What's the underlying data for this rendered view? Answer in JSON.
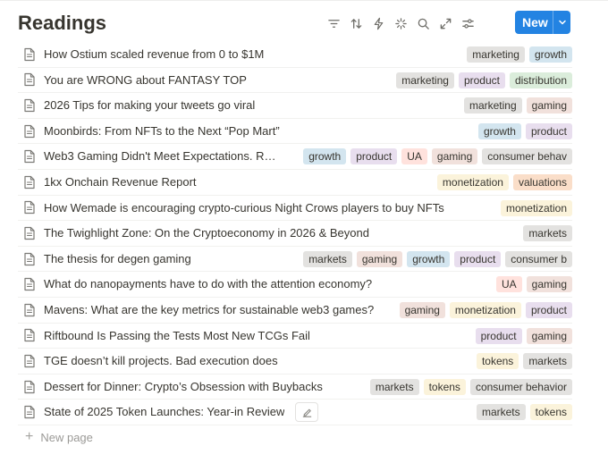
{
  "page": {
    "title": "Readings"
  },
  "toolbar": {
    "tools": [
      "filter-icon",
      "sort-icon",
      "automation-bolt-icon",
      "sparkle-icon",
      "search-icon",
      "expand-icon",
      "settings-sliders-icon"
    ],
    "new_label": "New"
  },
  "colors": {
    "marketing": "#e3e2e0",
    "growth": "#d3e5ef",
    "product": "#e8deee",
    "distribution": "#dbeddb",
    "gaming": "#f1e1dc",
    "UA": "#ffe2dd",
    "consumer behavior": "#e3e2e0",
    "monetization": "#fbf3db",
    "valuations": "#fadec9",
    "markets": "#e3e2e0",
    "tokens": "#fbf3db"
  },
  "rows": [
    {
      "name": "How Ostium scaled revenue from 0 to $1M",
      "tags": [
        "marketing",
        "growth"
      ]
    },
    {
      "name": "You are WRONG about FANTASY TOP",
      "tags": [
        "marketing",
        "product",
        "distribution"
      ]
    },
    {
      "name": "2026 Tips for making your tweets go viral",
      "tags": [
        "marketing",
        "gaming"
      ]
    },
    {
      "name": "Moonbirds: From NFTs to the Next “Pop Mart”",
      "tags": [
        "growth",
        "product"
      ]
    },
    {
      "name": "Web3 Gaming Didn't Meet Expectations. Rew...",
      "tags": [
        "growth",
        "product",
        "UA",
        "gaming",
        "consumer behav"
      ]
    },
    {
      "name": "1kx Onchain Revenue Report",
      "tags": [
        "monetization",
        "valuations"
      ]
    },
    {
      "name": "How Wemade is encouraging crypto-curious Night Crows players to buy NFTs",
      "tags": [
        "monetization"
      ]
    },
    {
      "name": "The Twighlight Zone: On the Cryptoeconomy in 2026 & Beyond",
      "tags": [
        "markets"
      ]
    },
    {
      "name": "The thesis for degen gaming",
      "tags": [
        "markets",
        "gaming",
        "growth",
        "product",
        "consumer b"
      ]
    },
    {
      "name": "What do nanopayments have to do with the attention economy?",
      "tags": [
        "UA",
        "gaming"
      ]
    },
    {
      "name": "Mavens: What are the key metrics for sustainable web3 games?",
      "tags": [
        "gaming",
        "monetization",
        "product"
      ]
    },
    {
      "name": "Riftbound Is Passing the Tests Most New TCGs Fail",
      "tags": [
        "product",
        "gaming"
      ]
    },
    {
      "name": "TGE doesn’t kill projects. Bad execution does",
      "tags": [
        "tokens",
        "markets"
      ]
    },
    {
      "name": "Dessert for Dinner: Crypto’s Obsession with Buybacks",
      "tags": [
        "markets",
        "tokens",
        "consumer behavior"
      ]
    },
    {
      "name": "State of 2025 Token Launches: Year-in Review",
      "tags": [
        "markets",
        "tokens"
      ],
      "edit_icon": "edit-pencil-icon"
    }
  ],
  "footer": {
    "new_page_label": "New page"
  }
}
